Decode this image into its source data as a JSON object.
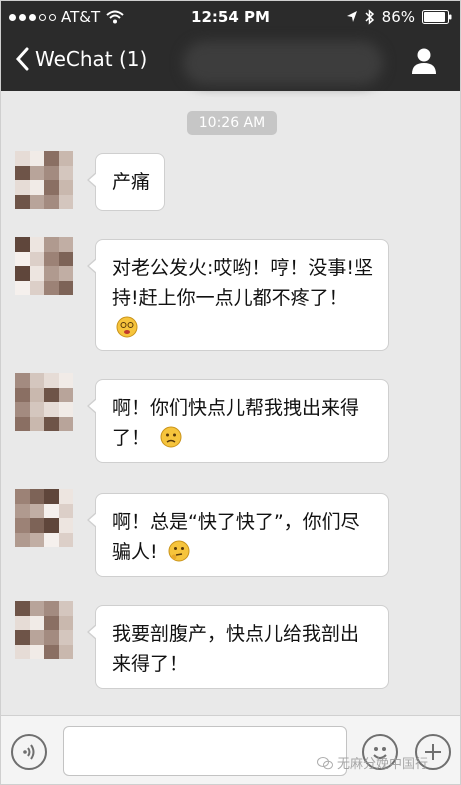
{
  "status_bar": {
    "carrier": "AT&T",
    "time": "12:54 PM",
    "battery": "86%",
    "signal_bars_filled": 3,
    "signal_bars_total": 5
  },
  "nav": {
    "back_label": "WeChat (1)",
    "back_icon": "chevron-left-icon",
    "profile_icon": "person-icon"
  },
  "chat": {
    "timestamp": "10:26 AM",
    "messages": [
      {
        "sender": "contact",
        "text": "产痛",
        "emoji": ""
      },
      {
        "sender": "contact",
        "text": "对老公发火:哎哟！哼！没事!坚持!赶上你一点儿都不疼了！",
        "emoji": "dizzy-face"
      },
      {
        "sender": "contact",
        "text": "啊！你们快点儿帮我拽出来得了！",
        "emoji": "confused-face"
      },
      {
        "sender": "contact",
        "text": "啊！总是“快了快了”，你们尽骗人!",
        "emoji": "thinking-face"
      },
      {
        "sender": "contact",
        "text": "我要剖腹产，快点儿给我剖出来得了！",
        "emoji": ""
      }
    ]
  },
  "input_bar": {
    "voice_icon": "voice-icon",
    "emoji_icon": "smiley-icon",
    "plus_icon": "plus-icon",
    "input_value": ""
  },
  "watermark": {
    "text": "无麻分娩中国行"
  },
  "colors": {
    "bar_background": "#2b2b2b",
    "chat_background": "#e9e9e9",
    "bubble_background": "#ffffff",
    "timestamp_background": "#c6c6c6"
  }
}
